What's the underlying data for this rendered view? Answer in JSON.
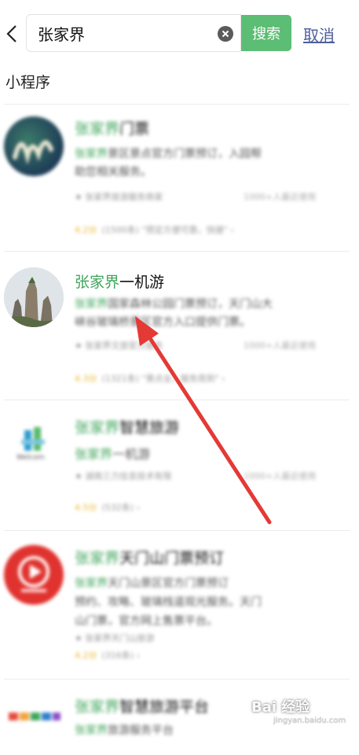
{
  "search": {
    "query": "张家界",
    "button_label": "搜索",
    "cancel_label": "取消"
  },
  "section_title": "小程序",
  "results": [
    {
      "title_highlight": "张家界",
      "title_rest": "门票",
      "desc1_highlight": "张家界",
      "desc1_rest": "景区景点官方门票预订，入园帮",
      "desc2": "助您相关服务。",
      "meta": "★ 张家界旅游服务商家",
      "meta_right": "1000+人最近使用",
      "score": "4.2分",
      "reviews": "(1500条) \"预定方便可靠，快捷\" ›"
    },
    {
      "title_highlight": "张家界",
      "title_rest": "一机游",
      "desc1_highlight": "张家界",
      "desc1_rest": "国家森林公园门票预订，天门山大",
      "desc2": "峡谷玻璃桥景区官方入口提供门票。",
      "meta": "★ 张家界文旅官方服务",
      "meta_right": "1000+人最近使用",
      "score": "4.3分",
      "reviews": "(1321条) \"景点全，服务周到\" ›"
    },
    {
      "title_highlight": "张家界",
      "title_rest": "智慧旅游",
      "desc1_highlight": "张家界",
      "desc1_rest": "一机游",
      "desc2": "",
      "meta": "★ 湖南三力信息技术有限",
      "meta_right": "1000+人最近使用",
      "score": "4.5分",
      "reviews": "(532条) ›",
      "logo_text": "Welcom"
    },
    {
      "title_highlight": "张家界",
      "title_rest": "天门山门票预订",
      "desc1_highlight": "张家界",
      "desc1_rest": "天门山景区官方门票预订",
      "desc2": "预约、攻略、玻璃栈道观光服务。天门",
      "desc3": "山门票，官方网上售票平台。",
      "meta": "★ 张家界天门山旅游",
      "meta_right": "",
      "score": "4.2分",
      "reviews": "(316条) ›"
    },
    {
      "title_highlight": "张家界",
      "title_rest": "智慧旅游平台",
      "desc1_highlight": "张家界",
      "desc1_rest": "旅游服务平台"
    }
  ],
  "colors": {
    "accent_green": "#5cbd74",
    "highlight_green": "#3fa55a",
    "link_blue": "#4e5f9c",
    "arrow_red": "#e53935"
  },
  "watermark": {
    "brand": "Bai 经验",
    "sub": "jingyan.baidu.com"
  }
}
